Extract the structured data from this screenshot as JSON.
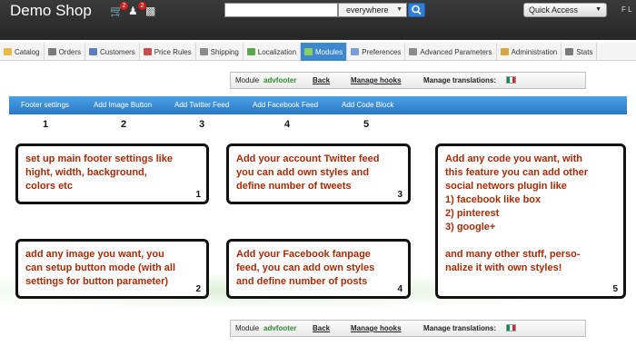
{
  "header": {
    "shop_title": "Demo Shop",
    "cart_badge": "2",
    "customers_badge": "2",
    "search": {
      "value": "",
      "scope": "everywhere"
    },
    "quick_access": "Quick Access",
    "user_initial": "F L"
  },
  "tabs": [
    {
      "label": "Catalog",
      "icon": "folder-icon",
      "color": "#e8b84a"
    },
    {
      "label": "Orders",
      "icon": "cart-icon",
      "color": "#7a7a7a"
    },
    {
      "label": "Customers",
      "icon": "customers-icon",
      "color": "#5a7fbf"
    },
    {
      "label": "Price Rules",
      "icon": "price-icon",
      "color": "#c94c4c"
    },
    {
      "label": "Shipping",
      "icon": "truck-icon",
      "color": "#8a8a8a"
    },
    {
      "label": "Localization",
      "icon": "globe-icon",
      "color": "#5aa84a"
    },
    {
      "label": "Modules",
      "icon": "puzzle-icon",
      "color": "#8ccf5a",
      "active": true
    },
    {
      "label": "Preferences",
      "icon": "preferences-icon",
      "color": "#7a9fd6"
    },
    {
      "label": "Advanced Parameters",
      "icon": "wrench-icon",
      "color": "#8a8a8a"
    },
    {
      "label": "Administration",
      "icon": "key-icon",
      "color": "#d6a640"
    },
    {
      "label": "Stats",
      "icon": "stats-icon",
      "color": "#7a7a7a"
    }
  ],
  "module_bar": {
    "module_label": "Module",
    "module_name": "advfooter",
    "back": "Back",
    "manage_hooks": "Manage hooks",
    "manage_translations": "Manage translations:",
    "flags": [
      {
        "name": "us-flag-icon",
        "colors": [
          "#b22234",
          "#ffffff",
          "#3c3b6e"
        ]
      },
      {
        "name": "br-flag-icon",
        "colors": [
          "#009c3b",
          "#ffdf00",
          "#002776"
        ]
      },
      {
        "name": "de-flag-icon",
        "colors": [
          "#000000",
          "#dd0000",
          "#ffce00"
        ]
      },
      {
        "name": "es-flag-icon",
        "colors": [
          "#aa151b",
          "#f1bf00",
          "#aa151b"
        ]
      },
      {
        "name": "fr-flag-icon",
        "colors": [
          "#0055a4",
          "#ffffff",
          "#ef4135"
        ]
      },
      {
        "name": "it-flag-icon",
        "colors": [
          "#009246",
          "#ffffff",
          "#ce2b37"
        ]
      }
    ]
  },
  "blue_tabs": [
    {
      "label": "Footer settings",
      "number": "1"
    },
    {
      "label": "Add Image Button",
      "number": "2"
    },
    {
      "label": "Add Twitter Feed",
      "number": "3"
    },
    {
      "label": "Add Facebook Feed",
      "number": "4"
    },
    {
      "label": "Add Code Block",
      "number": "5"
    }
  ],
  "boxes": [
    {
      "text": "set up main footer settings like\nhight, width, background,\ncolors etc",
      "number": "1"
    },
    {
      "text": "Add your account Twitter feed\nyou can add own styles and\ndefine number of tweets",
      "number": "3"
    },
    {
      "text": "Add any code you want, with\nthis feature you can add other\nsocial networs plugin like\n1) facebook like box\n2) pinterest\n3) google+\n\nand many other stuff, perso-\nnalize it with own styles!",
      "number": "5"
    },
    {
      "text": "add any image you want, you\ncan setup button mode (with all\nsettings for button parameter)",
      "number": "2"
    },
    {
      "text": "Add your Facebook fanpage\nfeed, you can add own styles\nand define number of posts",
      "number": "4"
    }
  ]
}
